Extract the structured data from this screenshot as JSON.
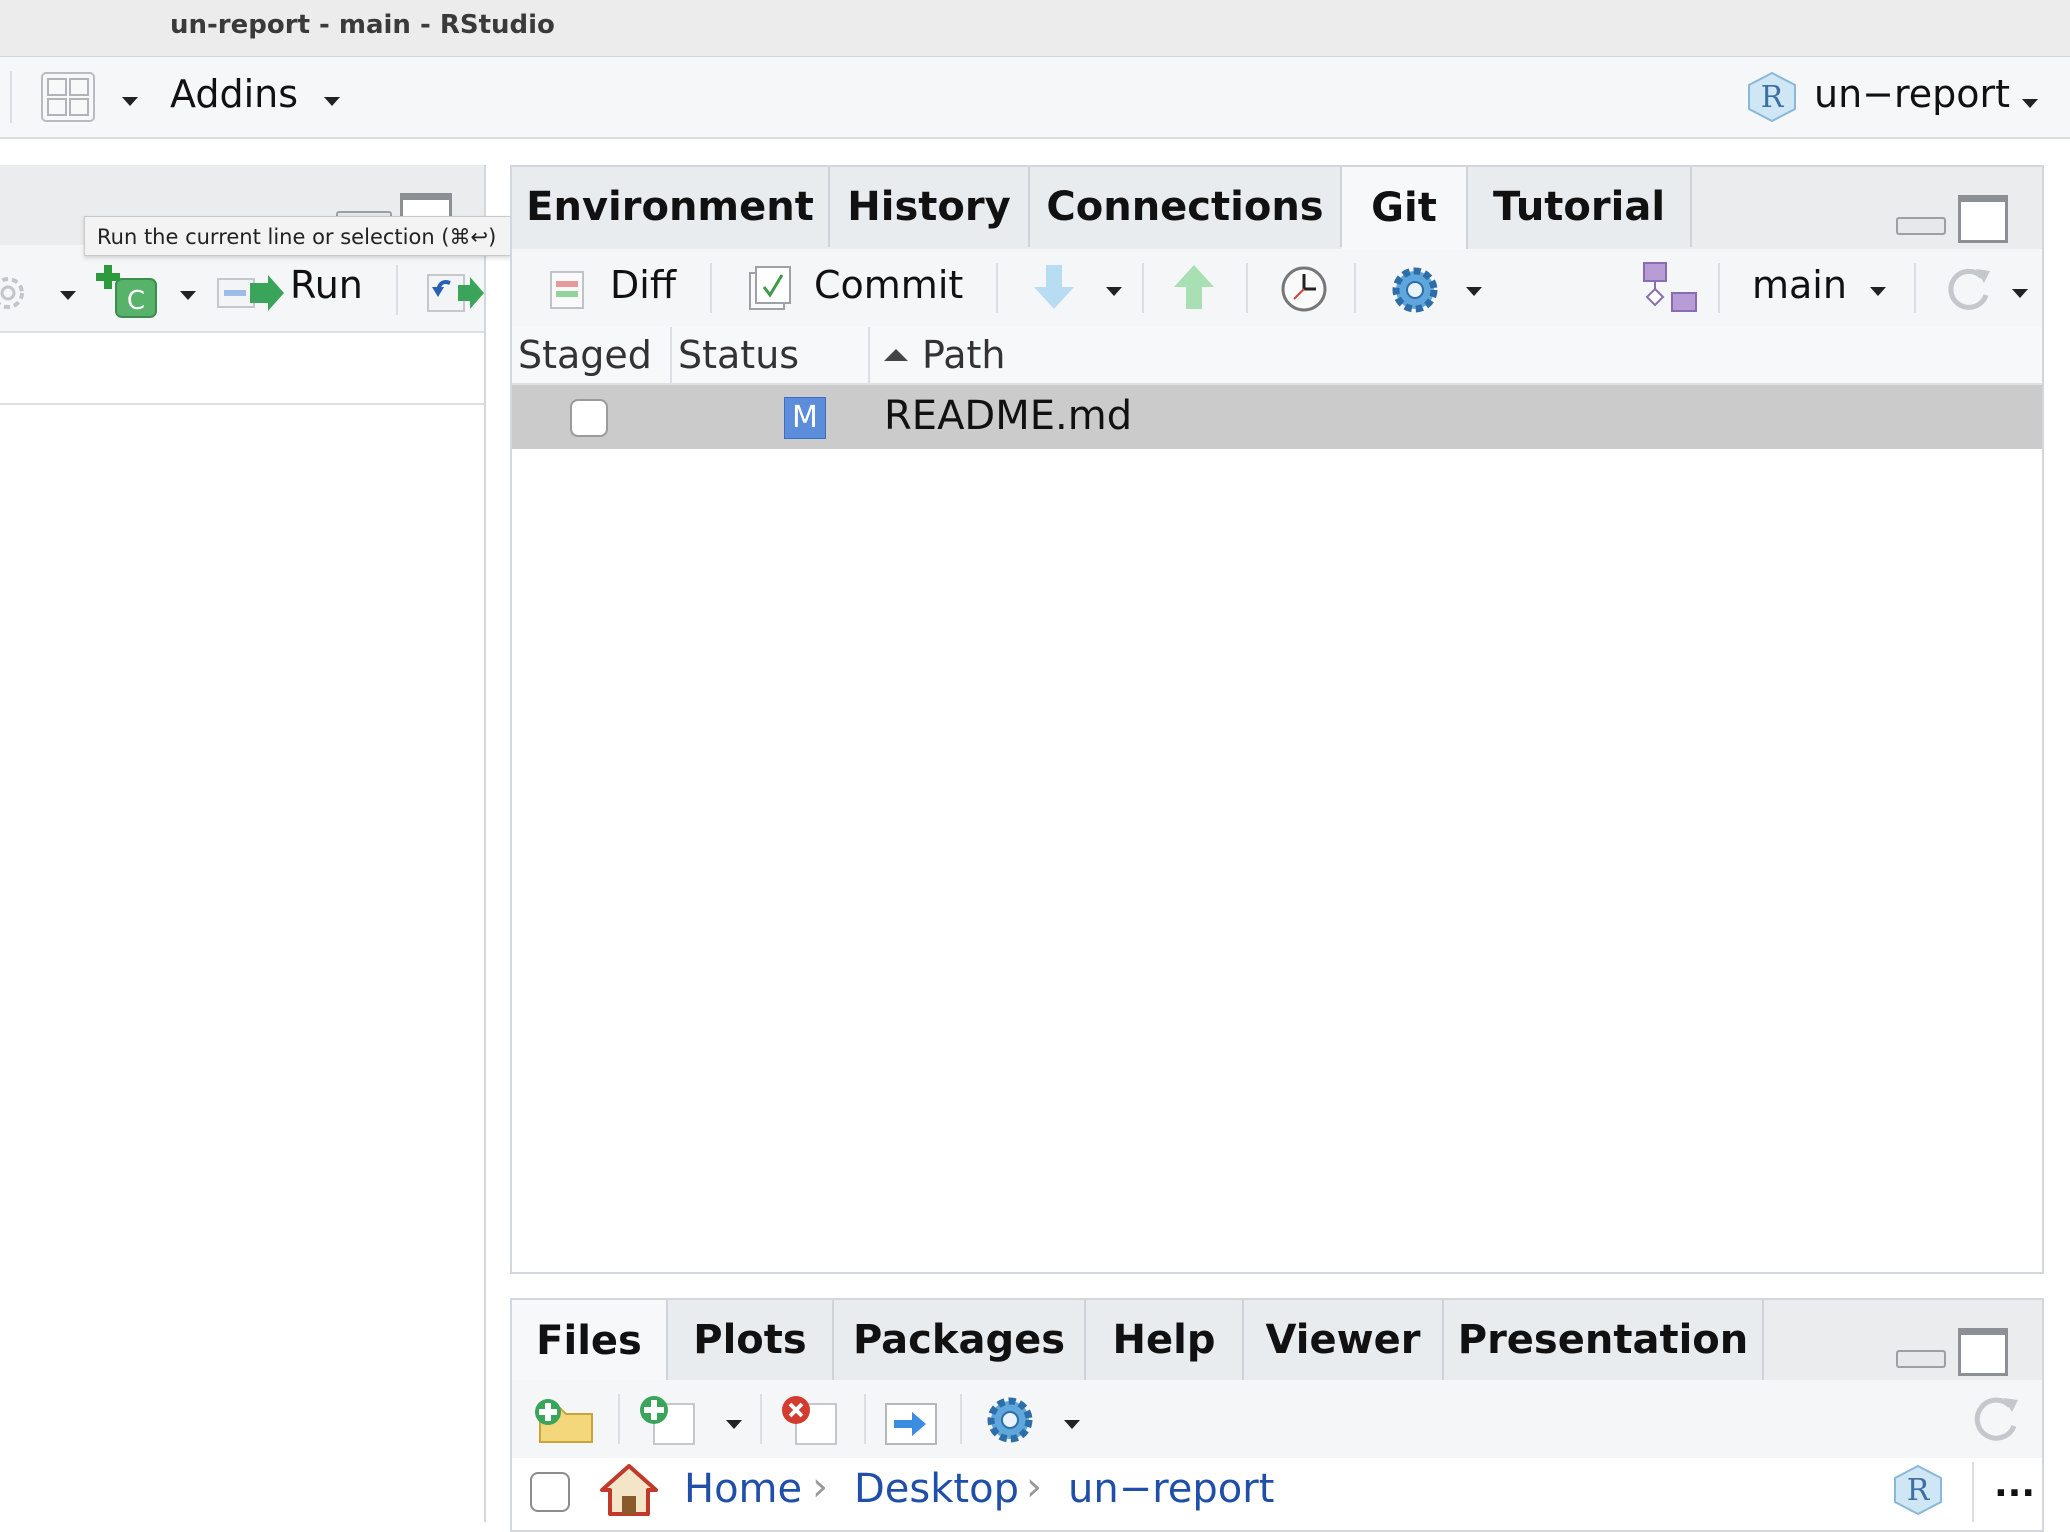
{
  "window": {
    "title": "un-report - main - RStudio"
  },
  "main_toolbar": {
    "addins_label": "Addins",
    "project_label": "un−report"
  },
  "source_pane": {
    "run_label": "Run",
    "tooltip": "Run the current line or selection (⌘↩)"
  },
  "git_pane": {
    "tabs": [
      {
        "label": "Environment"
      },
      {
        "label": "History"
      },
      {
        "label": "Connections"
      },
      {
        "label": "Git"
      },
      {
        "label": "Tutorial"
      }
    ],
    "toolbar": {
      "diff_label": "Diff",
      "commit_label": "Commit",
      "branch_label": "main"
    },
    "columns": {
      "staged": "Staged",
      "status": "Status",
      "path": "Path"
    },
    "rows": [
      {
        "status_badge": "M",
        "path": "README.md"
      }
    ]
  },
  "files_pane": {
    "tabs": [
      {
        "label": "Files"
      },
      {
        "label": "Plots"
      },
      {
        "label": "Packages"
      },
      {
        "label": "Help"
      },
      {
        "label": "Viewer"
      },
      {
        "label": "Presentation"
      }
    ],
    "breadcrumb": {
      "home": "Home",
      "desktop": "Desktop",
      "project": "un−report",
      "more": "..."
    }
  },
  "colors": {
    "modified_badge": "#5b8ddb",
    "run_arrow": "#3aa45a",
    "link": "#1f4fa8",
    "selected_row": "#cbcbcb"
  }
}
